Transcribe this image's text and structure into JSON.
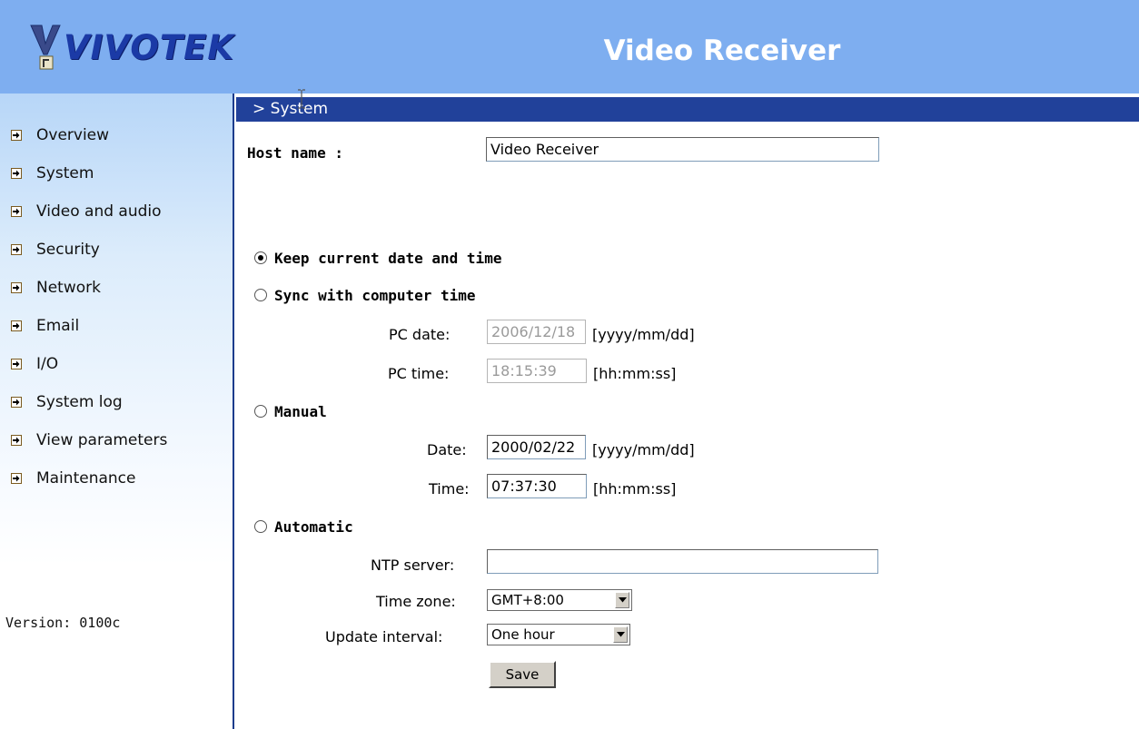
{
  "header": {
    "logo_text": "VIVOTEK",
    "title": "Video Receiver"
  },
  "sidebar": {
    "items": [
      {
        "label": "Overview"
      },
      {
        "label": "System"
      },
      {
        "label": "Video and audio"
      },
      {
        "label": "Security"
      },
      {
        "label": "Network"
      },
      {
        "label": "Email"
      },
      {
        "label": "I/O"
      },
      {
        "label": "System log"
      },
      {
        "label": "View parameters"
      },
      {
        "label": "Maintenance"
      }
    ],
    "version": "Version: 0100c"
  },
  "section": {
    "title": "> System"
  },
  "form": {
    "host_name_label": "Host name :",
    "host_name_value": "Video Receiver",
    "keep_label": "Keep current date and time",
    "sync_label": "Sync with computer time",
    "pc_date_label": "PC date:",
    "pc_date_value": "2006/12/18",
    "pc_date_format": "[yyyy/mm/dd]",
    "pc_time_label": "PC time:",
    "pc_time_value": "18:15:39",
    "pc_time_format": "[hh:mm:ss]",
    "manual_label": "Manual",
    "date_label": "Date:",
    "date_value": "2000/02/22",
    "date_format": "[yyyy/mm/dd]",
    "time_label": "Time:",
    "time_value": "07:37:30",
    "time_format": "[hh:mm:ss]",
    "automatic_label": "Automatic",
    "ntp_label": "NTP server:",
    "ntp_value": "",
    "timezone_label": "Time zone:",
    "timezone_value": "GMT+8:00",
    "interval_label": "Update interval:",
    "interval_value": "One hour",
    "save_label": "Save",
    "selected_mode": "keep"
  },
  "colors": {
    "header_bg": "#7eaef0",
    "section_bar": "#21419a",
    "logo": "#1b3aa6"
  }
}
